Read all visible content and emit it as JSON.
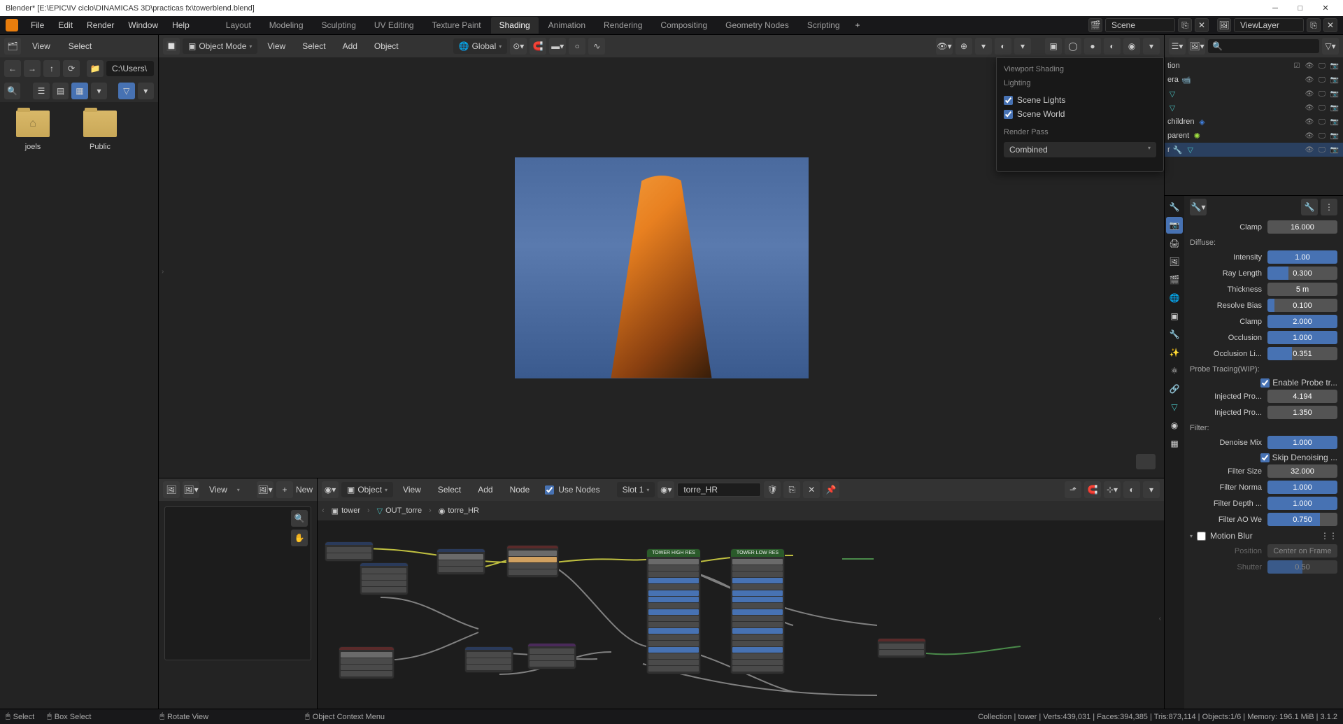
{
  "titlebar": {
    "text": "Blender* [E:\\EPIC\\IV ciclo\\DINAMICAS 3D\\practicas fx\\towerblend.blend]"
  },
  "topmenu": {
    "file": "File",
    "edit": "Edit",
    "render": "Render",
    "window": "Window",
    "help": "Help"
  },
  "workspaces": {
    "layout": "Layout",
    "modeling": "Modeling",
    "sculpting": "Sculpting",
    "uv": "UV Editing",
    "texture": "Texture Paint",
    "shading": "Shading",
    "animation": "Animation",
    "rendering": "Rendering",
    "compositing": "Compositing",
    "geometry": "Geometry Nodes",
    "scripting": "Scripting"
  },
  "scene": {
    "label": "Scene"
  },
  "viewlayer": {
    "label": "ViewLayer"
  },
  "filebrowser": {
    "view": "View",
    "select": "Select",
    "path": "C:\\Users\\",
    "folders": [
      {
        "name": "joels",
        "home": true
      },
      {
        "name": "Public",
        "home": false
      }
    ]
  },
  "viewport": {
    "mode": "Object Mode",
    "view": "View",
    "select": "Select",
    "add": "Add",
    "object": "Object",
    "orientation": "Global"
  },
  "shading_popup": {
    "title": "Viewport Shading",
    "lighting": "Lighting",
    "scene_lights": "Scene Lights",
    "scene_world": "Scene World",
    "render_pass": "Render Pass",
    "pass_value": "Combined"
  },
  "node_editor": {
    "view": "View",
    "select": "Select",
    "add": "Add",
    "node": "Node",
    "use_nodes": "Use Nodes",
    "slot": "Slot 1",
    "material": "torre_HR",
    "mode": "Object",
    "new": "New",
    "breadcrumb": {
      "obj": "tower",
      "group": "OUT_torre",
      "mat": "torre_HR"
    },
    "node_high": "TOWER HIGH RES",
    "node_low": "TOWER LOW RES"
  },
  "outliner": {
    "items": {
      "collection": "tion",
      "camera": "era",
      "empty": "",
      "children": "children",
      "parent": "parent",
      "tower": "r"
    }
  },
  "properties": {
    "clamp1": {
      "label": "Clamp",
      "value": "16.000"
    },
    "diffuse": "Diffuse:",
    "intensity": {
      "label": "Intensity",
      "value": "1.00"
    },
    "raylength": {
      "label": "Ray Length",
      "value": "0.300"
    },
    "thickness": {
      "label": "Thickness",
      "value": "5 m"
    },
    "resolvebias": {
      "label": "Resolve Bias",
      "value": "0.100"
    },
    "clamp2": {
      "label": "Clamp",
      "value": "2.000"
    },
    "occlusion": {
      "label": "Occlusion",
      "value": "1.000"
    },
    "occlusionli": {
      "label": "Occlusion Li...",
      "value": "0.351"
    },
    "probetracing": "Probe Tracing(WIP):",
    "enableprobe": {
      "label": "Enable Probe tr..."
    },
    "injected1": {
      "label": "Injected Pro...",
      "value": "4.194"
    },
    "injected2": {
      "label": "Injected Pro...",
      "value": "1.350"
    },
    "filter": "Filter:",
    "denoisemix": {
      "label": "Denoise Mix",
      "value": "1.000"
    },
    "skipdenoise": {
      "label": "Skip Denoising ..."
    },
    "filtersize": {
      "label": "Filter Size",
      "value": "32.000"
    },
    "filternorma": {
      "label": "Filter Norma",
      "value": "1.000"
    },
    "filterdepth": {
      "label": "Filter Depth ...",
      "value": "1.000"
    },
    "filterao": {
      "label": "Filter AO We",
      "value": "0.750"
    },
    "motionblur": "Motion Blur",
    "position": {
      "label": "Position",
      "value": "Center on Frame"
    },
    "shutter": {
      "label": "Shutter",
      "value": "0.50"
    }
  },
  "statusbar": {
    "select": "Select",
    "box": "Box Select",
    "rotate": "Rotate View",
    "context": "Object Context Menu",
    "stats": "Collection | tower | Verts:439,031 | Faces:394,385 | Tris:873,114 | Objects:1/6 | Memory: 196.1 MiB | 3.1.2"
  }
}
